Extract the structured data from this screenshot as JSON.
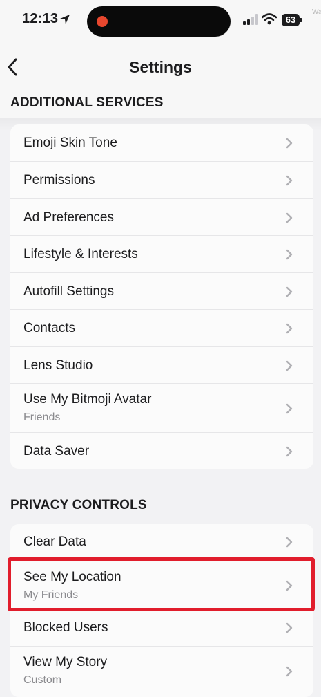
{
  "status_bar": {
    "time": "12:13",
    "battery": "63",
    "watermark": "Wa"
  },
  "nav": {
    "title": "Settings"
  },
  "sections": {
    "additional_services": {
      "title": "ADDITIONAL SERVICES",
      "items": [
        {
          "label": "Emoji Skin Tone"
        },
        {
          "label": "Permissions"
        },
        {
          "label": "Ad Preferences"
        },
        {
          "label": "Lifestyle & Interests"
        },
        {
          "label": "Autofill Settings"
        },
        {
          "label": "Contacts"
        },
        {
          "label": "Lens Studio"
        },
        {
          "label": "Use My Bitmoji Avatar",
          "sub": "Friends"
        },
        {
          "label": "Data Saver"
        }
      ]
    },
    "privacy_controls": {
      "title": "PRIVACY CONTROLS",
      "items": [
        {
          "label": "Clear Data"
        },
        {
          "label": "See My Location",
          "sub": "My Friends"
        },
        {
          "label": "Blocked Users"
        },
        {
          "label": "View My Story",
          "sub": "Custom"
        }
      ]
    }
  },
  "colors": {
    "highlight": "#e11d2c",
    "background": "#f2f2f4"
  }
}
